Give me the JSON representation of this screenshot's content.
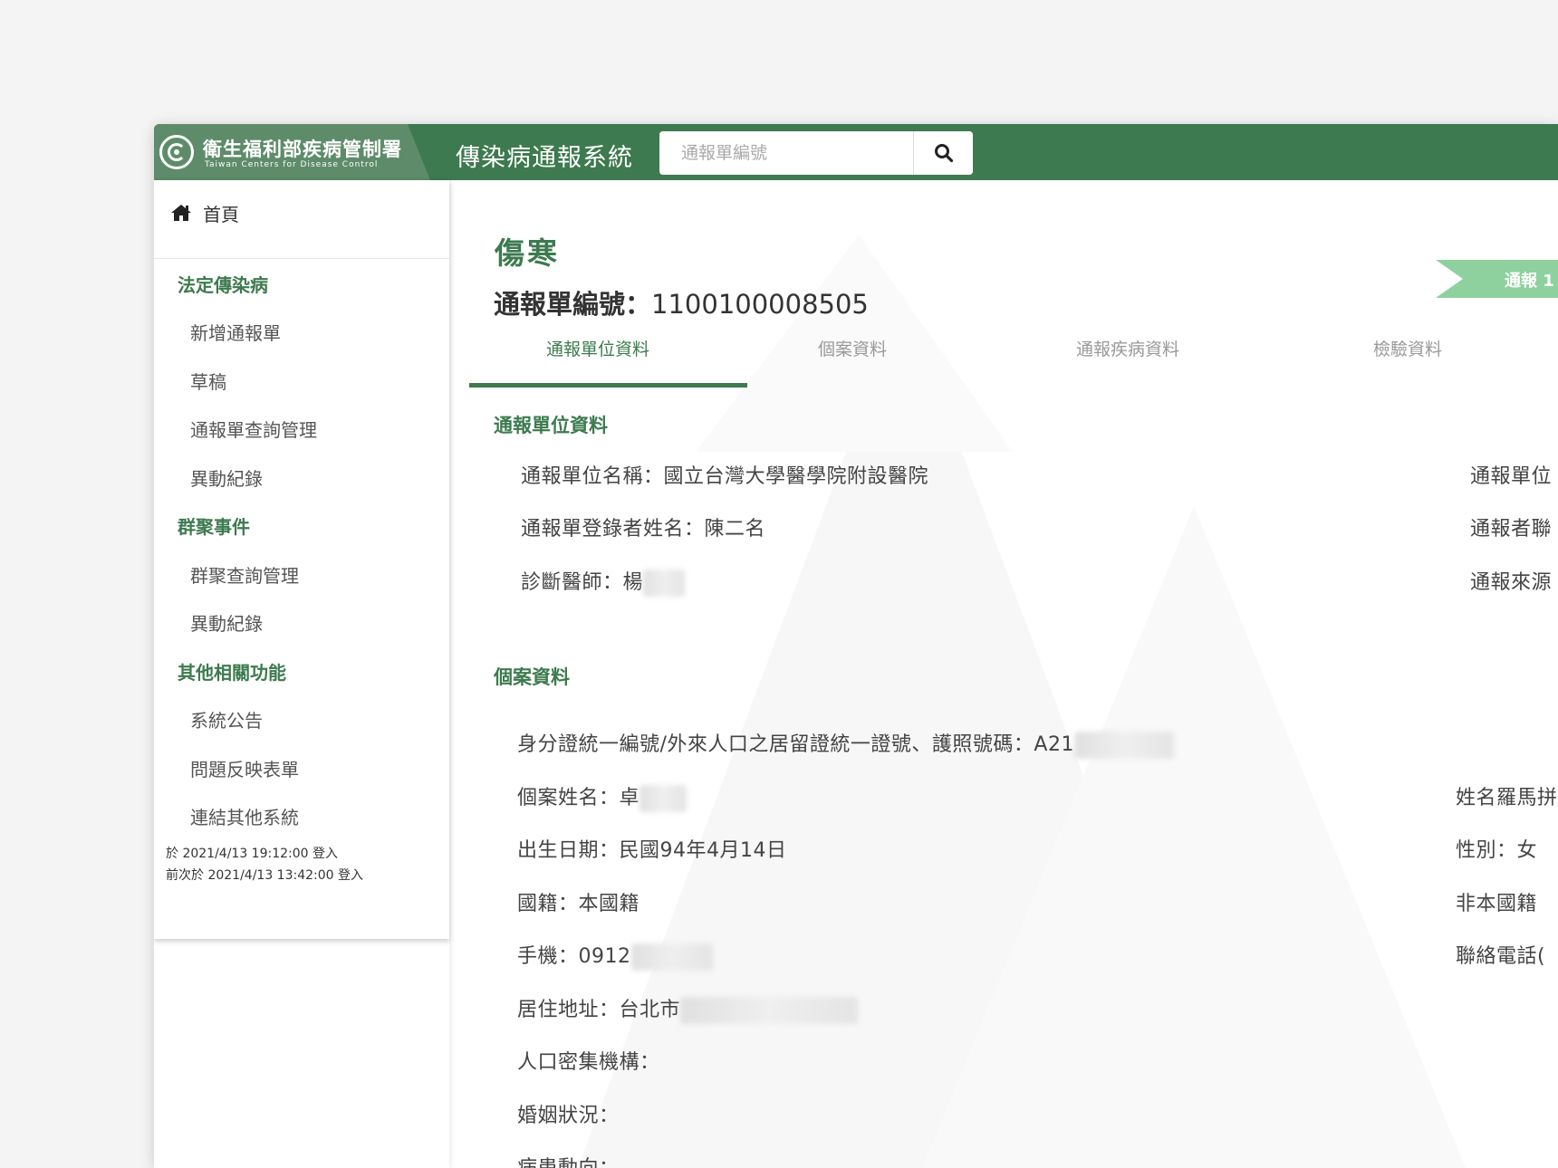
{
  "header": {
    "org_zh": "衛生福利部疾病管制署",
    "org_en": "Taiwan Centers for Disease Control",
    "app_title": "傳染病通報系統",
    "search_placeholder": "通報單編號",
    "brand_color": "#3d7a4f"
  },
  "sidebar": {
    "home": "首頁",
    "groups": [
      {
        "label": "法定傳染病",
        "items": [
          "新增通報單",
          "草稿",
          "通報單查詢管理",
          "異動紀錄"
        ]
      },
      {
        "label": "群聚事件",
        "items": [
          "群聚查詢管理",
          "異動紀錄"
        ]
      },
      {
        "label": "其他相關功能",
        "items": [
          "系統公告",
          "問題反映表單",
          "連結其他系統"
        ]
      }
    ],
    "login_current": "於 2021/4/13 19:12:00 登入",
    "login_previous": "前次於 2021/4/13 13:42:00 登入"
  },
  "main": {
    "disease": "傷寒",
    "report_no_label": "通報單編號：",
    "report_no": "1100100008505",
    "flag_text": "通報 1",
    "tabs": [
      "通報單位資料",
      "個案資料",
      "通報疾病資料",
      "檢驗資料"
    ],
    "sections": {
      "unit": {
        "title": "通報單位資料",
        "left": [
          "通報單位名稱：國立台灣大學醫學院附設醫院",
          "通報單登錄者姓名：陳二名",
          "診斷醫師：楊"
        ],
        "right": [
          "通報單位",
          "通報者聯",
          "通報來源"
        ]
      },
      "case": {
        "title": "個案資料",
        "left": [
          "身分證統一編號/外來人口之居留證統一證號、護照號碼：A21",
          "個案姓名：卓",
          "出生日期：民國94年4月14日",
          "國籍：本國籍",
          "手機：0912",
          "居住地址：台北市",
          "人口密集機構：",
          "婚姻狀況：",
          "病患動向："
        ],
        "right": [
          "姓名羅馬拼",
          "性別：女",
          "非本國籍",
          "聯絡電話("
        ]
      }
    }
  }
}
